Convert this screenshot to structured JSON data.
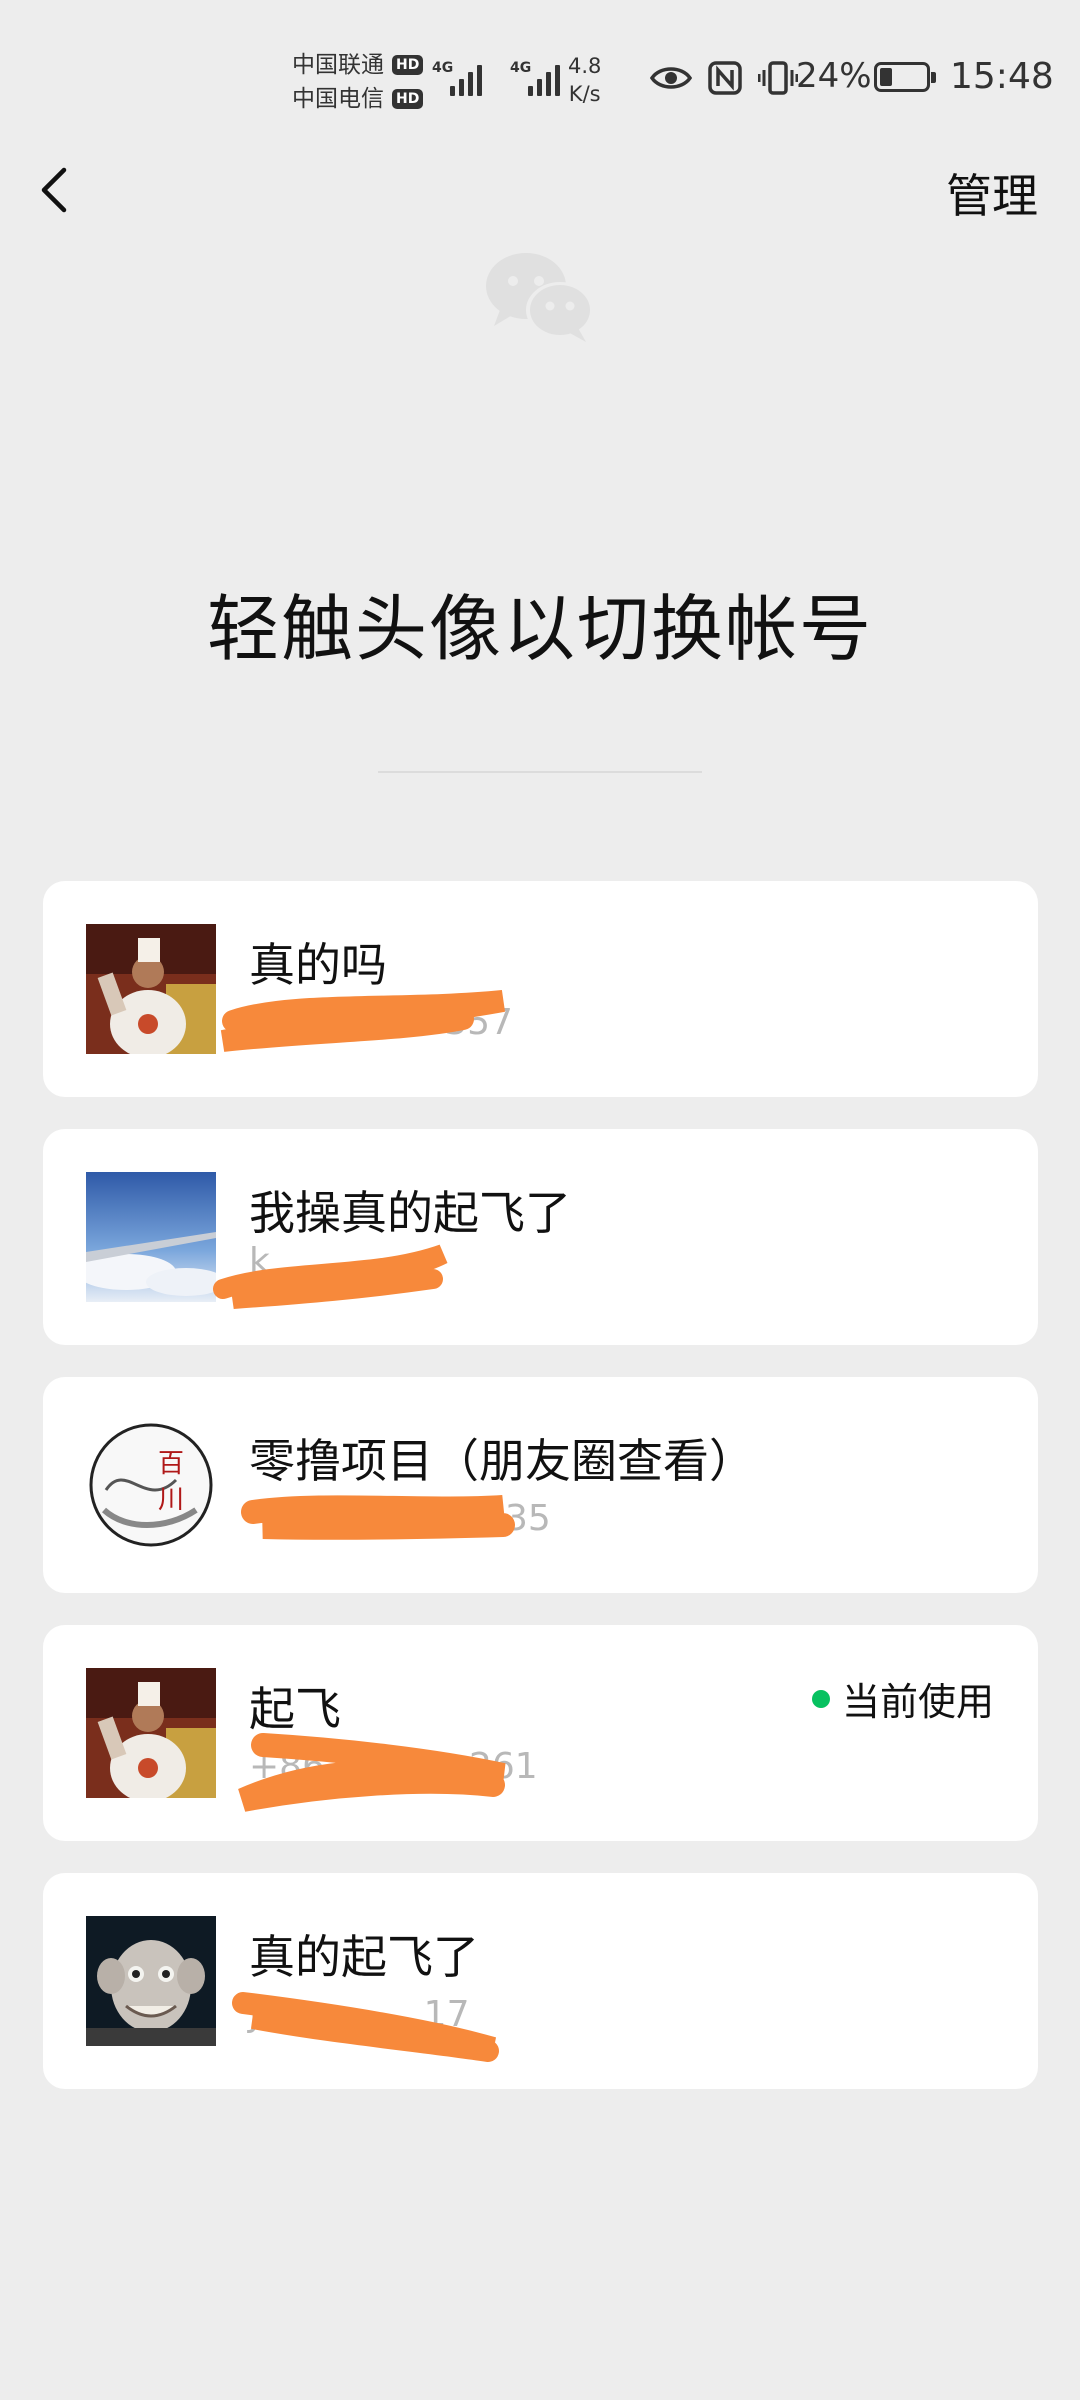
{
  "status_bar": {
    "carrier_1": "中国联通",
    "carrier_2": "中国电信",
    "hd_badge": "HD",
    "network_type": "4G",
    "net_speed_value": "4.8",
    "net_speed_unit": "K/s",
    "battery_percent": "24%",
    "battery_level": 0.24,
    "time": "15:48"
  },
  "nav": {
    "back_icon": "chevron-left-icon",
    "manage_label": "管理"
  },
  "header": {
    "logo_icon": "wechat-logo-icon",
    "title": "轻触头像以切换帐号"
  },
  "accounts": [
    {
      "name": "真的吗",
      "id_visible": "Q　　　　7357",
      "current": false
    },
    {
      "name": "我操真的起飞了",
      "id_visible": "k",
      "current": false
    },
    {
      "name": "零撸项目（朋友圈查看）",
      "id_visible": "+86　　　　　35",
      "current": false
    },
    {
      "name": "起飞",
      "id_visible": "+86　　　　261",
      "current": true,
      "current_label": "当前使用"
    },
    {
      "name": "真的起飞了",
      "id_visible": "JL　　　　17",
      "current": false
    }
  ],
  "colors": {
    "background": "#ededed",
    "card": "#ffffff",
    "active_dot": "#07c160",
    "redaction": "#f7893b",
    "secondary_text": "#b8b8b8"
  }
}
